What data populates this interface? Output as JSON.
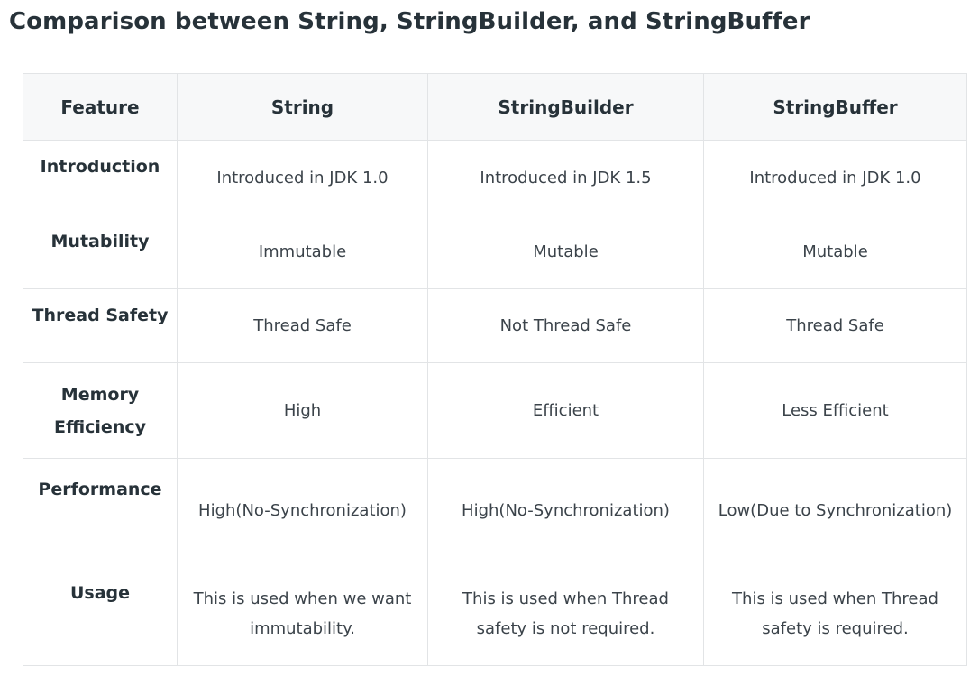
{
  "page": {
    "title": "Comparison between String, StringBuilder, and StringBuffer"
  },
  "table": {
    "headers": [
      "Feature",
      "String",
      "StringBuilder",
      "StringBuffer"
    ],
    "rows": [
      {
        "feature": "Introduction",
        "string": "Introduced in JDK 1.0",
        "stringbuilder": "Introduced in JDK 1.5",
        "stringbuffer": "Introduced in JDK 1.0"
      },
      {
        "feature": "Mutability",
        "string": "Immutable",
        "stringbuilder": "Mutable",
        "stringbuffer": "Mutable"
      },
      {
        "feature": "Thread Safety",
        "string": "Thread Safe",
        "stringbuilder": "Not Thread Safe",
        "stringbuffer": "Thread Safe"
      },
      {
        "feature": "Memory Efficiency",
        "string": "High",
        "stringbuilder": "Efficient",
        "stringbuffer": "Less Efficient"
      },
      {
        "feature": "Performance",
        "string": "High(No-Synchronization)",
        "stringbuilder": "High(No-Synchronization)",
        "stringbuffer": "Low(Due to Synchronization)"
      },
      {
        "feature": "Usage",
        "string": "This is used when we want immutability.",
        "stringbuilder": "This is used when Thread safety is not required.",
        "stringbuffer": "This is used when Thread safety is required."
      }
    ]
  }
}
